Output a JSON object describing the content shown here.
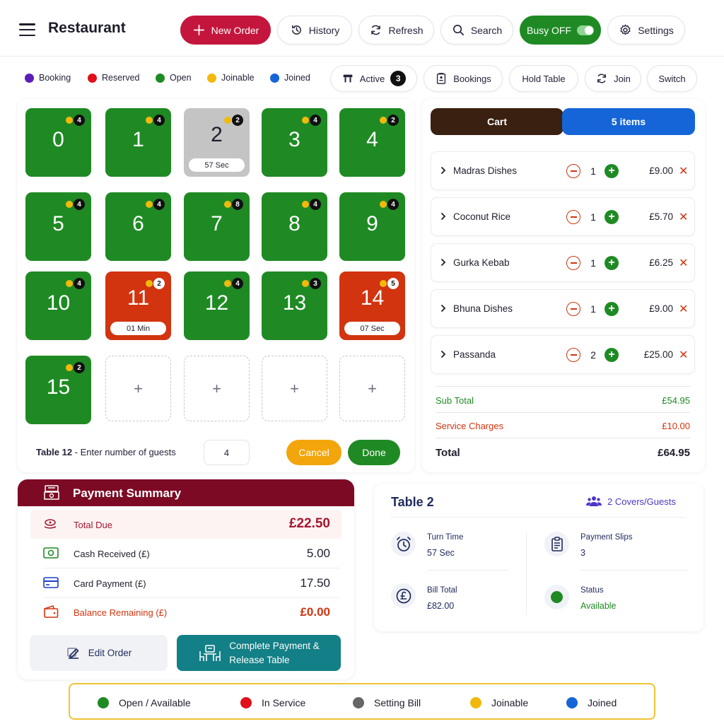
{
  "header": {
    "title": "Restaurant",
    "new_order": "New Order",
    "history": "History",
    "refresh": "Refresh",
    "search": "Search",
    "busy": "Busy OFF",
    "settings": "Settings"
  },
  "status_legend": {
    "booking": "Booking",
    "reserved": "Reserved",
    "open": "Open",
    "joinable": "Joinable",
    "joined": "Joined"
  },
  "actions": {
    "active": "Active",
    "active_count": "3",
    "bookings": "Bookings",
    "hold_table": "Hold Table",
    "join": "Join",
    "switch": "Switch"
  },
  "tables": [
    {
      "num": "0",
      "guests": "4",
      "timer": ""
    },
    {
      "num": "1",
      "guests": "4",
      "timer": ""
    },
    {
      "num": "2",
      "guests": "2",
      "timer": "57 Sec"
    },
    {
      "num": "3",
      "guests": "4",
      "timer": ""
    },
    {
      "num": "4",
      "guests": "2",
      "timer": ""
    },
    {
      "num": "5",
      "guests": "4",
      "timer": ""
    },
    {
      "num": "6",
      "guests": "4",
      "timer": ""
    },
    {
      "num": "7",
      "guests": "8",
      "timer": ""
    },
    {
      "num": "8",
      "guests": "4",
      "timer": ""
    },
    {
      "num": "9",
      "guests": "4",
      "timer": ""
    },
    {
      "num": "10",
      "guests": "4",
      "timer": ""
    },
    {
      "num": "11",
      "guests": "2",
      "timer": "01 Min"
    },
    {
      "num": "12",
      "guests": "4",
      "timer": ""
    },
    {
      "num": "13",
      "guests": "3",
      "timer": ""
    },
    {
      "num": "14",
      "guests": "5",
      "timer": "07 Sec"
    },
    {
      "num": "15",
      "guests": "2",
      "timer": ""
    }
  ],
  "add_symbol": "+",
  "guest_prompt": {
    "table": "Table 12",
    "text": " - Enter number of guests",
    "value": "4",
    "cancel": "Cancel",
    "done": "Done"
  },
  "cart": {
    "tab_cart": "Cart",
    "tab_items": "5 items",
    "items": [
      {
        "name": "Madras Dishes",
        "qty": "1",
        "price": "£9.00"
      },
      {
        "name": "Coconut Rice",
        "qty": "1",
        "price": "£5.70"
      },
      {
        "name": "Gurka Kebab",
        "qty": "1",
        "price": "£6.25"
      },
      {
        "name": "Bhuna Dishes",
        "qty": "1",
        "price": "£9.00"
      },
      {
        "name": "Passanda",
        "qty": "2",
        "price": "£25.00"
      }
    ],
    "remove_symbol": "✕",
    "subtotal_label": "Sub Total",
    "subtotal": "£54.95",
    "service_label": "Service Charges",
    "service": "£10.00",
    "total_label": "Total",
    "total": "£64.95"
  },
  "payment": {
    "title": "Payment Summary",
    "total_due_label": "Total Due",
    "total_due": "£22.50",
    "cash_label": "Cash Received (£)",
    "cash": "5.00",
    "card_label": "Card Payment (£)",
    "card": "17.50",
    "balance_label": "Balance Remaining (£)",
    "balance": "£0.00",
    "edit_order": "Edit Order",
    "complete_line1": "Complete Payment &",
    "complete_line2": "Release Table"
  },
  "table_info": {
    "title": "Table 2",
    "covers": "2 Covers/Guests",
    "turn_time_label": "Turn Time",
    "turn_time": "57 Sec",
    "payment_slips_label": "Payment Slips",
    "payment_slips": "3",
    "bill_total_label": "Bill Total",
    "bill_total": "£82.00",
    "status_label": "Status",
    "status": "Available"
  },
  "bottom_legend": {
    "open": "Open / Available",
    "in_service": "In Service",
    "setting_bill": "Setting Bill",
    "joinable": "Joinable",
    "joined": "Joined"
  },
  "colors": {
    "open_green": "#1f8a24",
    "service_red": "#d2340f",
    "setting_grey": "#c4c4c4",
    "joinable_yellow": "#f2b90c",
    "joined_blue": "#1565d8",
    "booking_purple": "#5a1fb5",
    "brand_red": "#c4163c",
    "payment_header": "#7c0a24",
    "complete_teal": "#137f86"
  }
}
